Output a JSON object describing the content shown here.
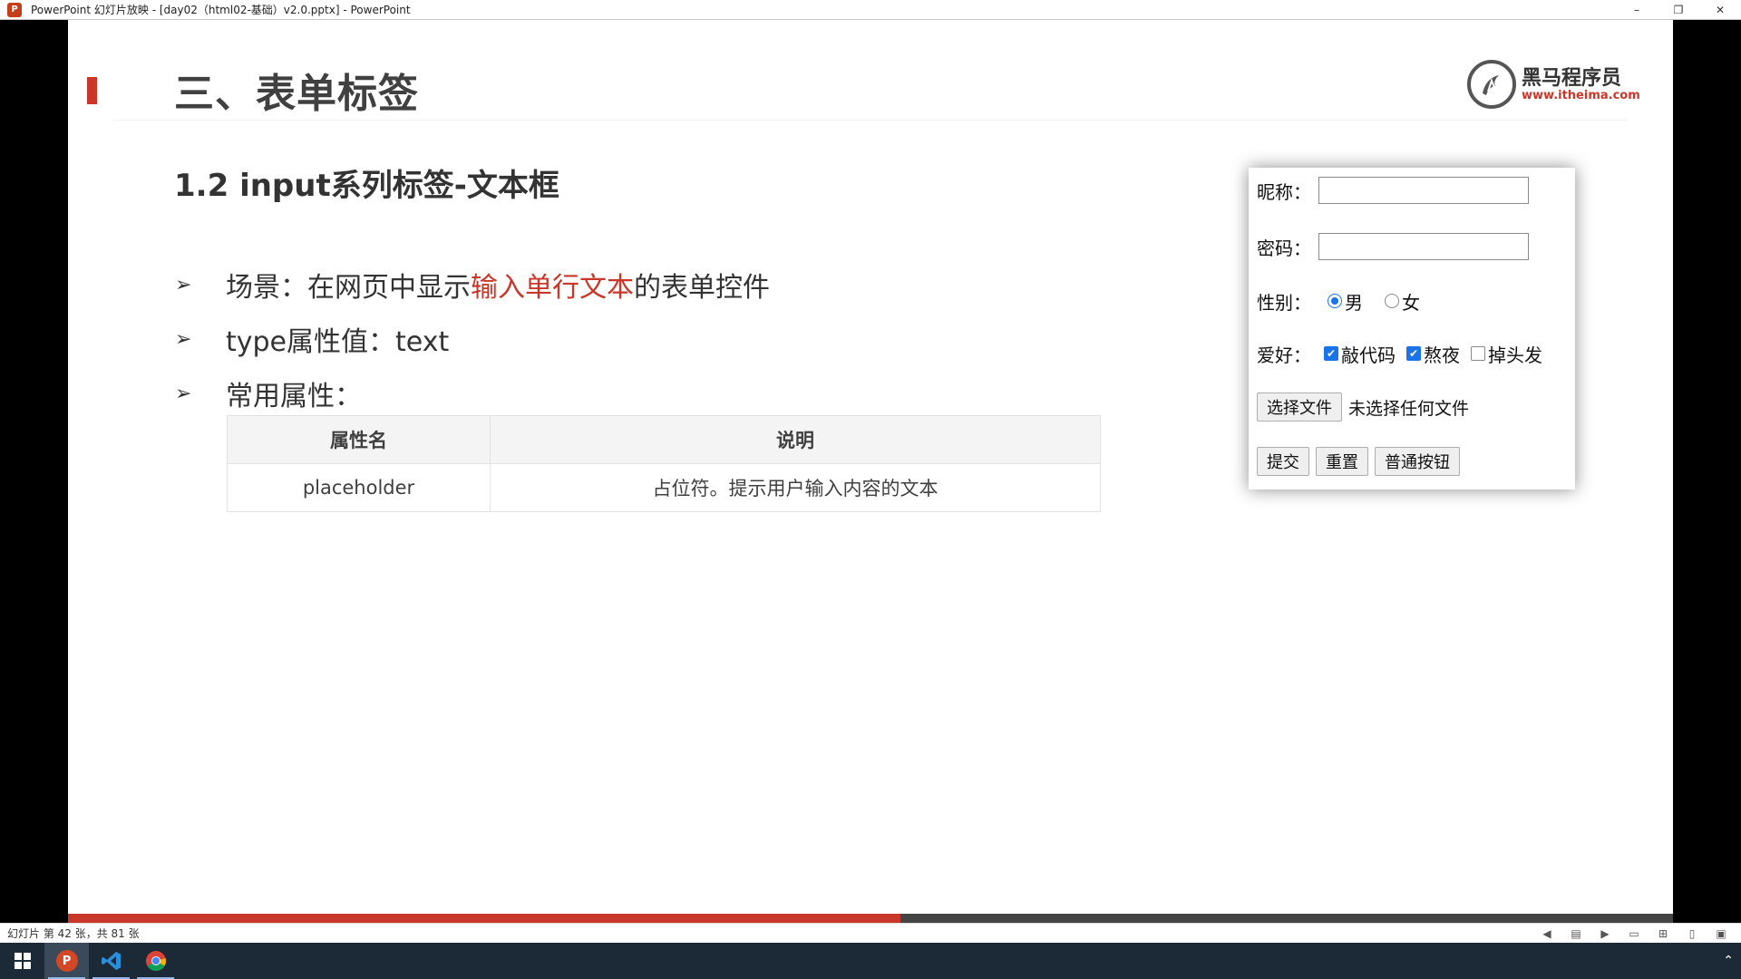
{
  "window": {
    "title": "PowerPoint 幻灯片放映 - [day02（html02-基础）v2.0.pptx] - PowerPoint",
    "app_icon_letter": "P",
    "controls": [
      "–",
      "❐",
      "✕"
    ]
  },
  "slide": {
    "title": "三、表单标签",
    "logo": {
      "name": "黑马程序员",
      "url": "www.itheima.com"
    },
    "subtitle": "1.2 input系列标签-文本框",
    "bullets": [
      {
        "prefix": "场景：在网页中显示",
        "highlight": "输入单行文本",
        "suffix": "的表单控件"
      },
      {
        "text": "type属性值：text"
      },
      {
        "text": "常用属性："
      }
    ],
    "table": {
      "headers": [
        "属性名",
        "说明"
      ],
      "rows": [
        [
          "placeholder",
          "占位符。提示用户输入内容的文本"
        ]
      ]
    },
    "form_demo": {
      "nickname_label": "昵称：",
      "password_label": "密码：",
      "gender_label": "性别：",
      "gender_options": [
        {
          "label": "男",
          "checked": true
        },
        {
          "label": "女",
          "checked": false
        }
      ],
      "hobby_label": "爱好：",
      "hobbies": [
        {
          "label": "敲代码",
          "checked": true
        },
        {
          "label": "熬夜",
          "checked": true
        },
        {
          "label": "掉头发",
          "checked": false
        }
      ],
      "file_button": "选择文件",
      "file_status": "未选择任何文件",
      "buttons": [
        "提交",
        "重置",
        "普通按钮"
      ]
    }
  },
  "progress": {
    "current": 42,
    "total": 81,
    "fraction": 0.5185
  },
  "statusbar": {
    "text": "幻灯片 第 42 张，共 81 张"
  },
  "colors": {
    "accent": "#c8372a",
    "text": "#404040",
    "checkbox": "#1a73e8",
    "taskbar": "#1c2a38"
  },
  "taskbar": {
    "apps": [
      "windows-start",
      "powerpoint",
      "vscode",
      "chrome"
    ]
  }
}
